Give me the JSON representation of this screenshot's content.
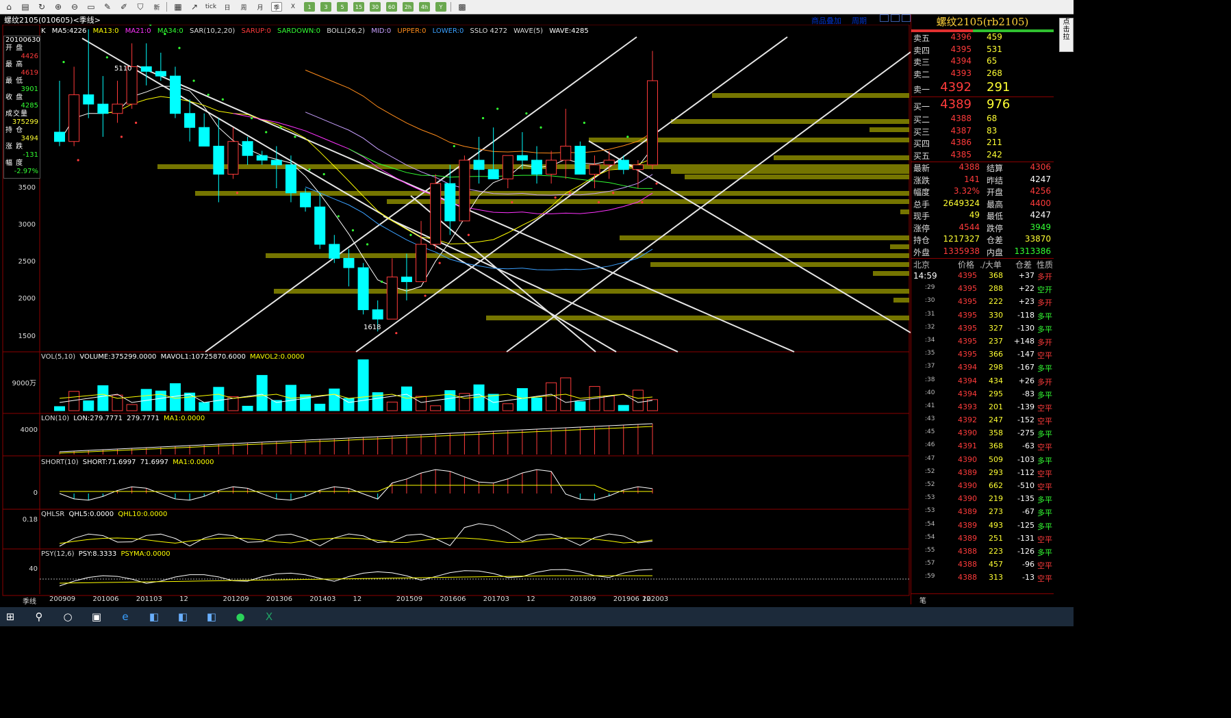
{
  "window": {
    "title": "螺纹2105(010605)<季线>",
    "links": [
      "商品叠加",
      "周期"
    ]
  },
  "toolbar": {
    "icons": [
      "home-icon",
      "folder-icon",
      "refresh-icon",
      "zoom-in-icon",
      "zoom-out-icon",
      "window-icon",
      "pen-icon",
      "brush-icon",
      "filter-icon",
      "new-icon",
      "table-icon",
      "line-chart-icon",
      "tick-icon",
      "day-icon",
      "week-icon",
      "month-icon",
      "quarter-icon",
      "x-icon",
      "p1-icon",
      "p3-icon",
      "p5-icon",
      "p15-icon",
      "p30-icon",
      "p60-icon",
      "p2h-icon",
      "p4h-icon",
      "y-icon",
      "calc-icon"
    ],
    "labels": [
      "",
      "",
      "",
      "",
      "",
      "",
      "",
      "",
      "",
      "新",
      "",
      "",
      "tick",
      "日",
      "周",
      "月",
      "季",
      "X",
      "1",
      "3",
      "5",
      "15",
      "30",
      "60",
      "2h",
      "4h",
      "Y",
      ""
    ]
  },
  "main_indicators": {
    "k_label": "K",
    "ma5": "MA5:4226",
    "ma13": "MA13:0",
    "ma21": "MA21:0",
    "ma34": "MA34:0",
    "sar": "SAR(10,2,20)",
    "sarup": "SARUP:0",
    "sardown": "SARDOWN:0",
    "boll": "BOLL(26,2)",
    "mid": "MID:0",
    "upper": "UPPER:0",
    "lower": "LOWER:0",
    "sslo": "SSLO 4272",
    "wave5": "WAVE(5)",
    "wave": "WAVE:4285"
  },
  "info_box": {
    "date": "20100630",
    "open_label": "开 盘",
    "open": "4426",
    "high_label": "最 高",
    "high": "4619",
    "low_label": "最 低",
    "low": "3901",
    "close_label": "收 盘",
    "close": "4285",
    "vol_label": "成交量",
    "vol": "375299",
    "oi_label": "持 仓",
    "oi": "3494",
    "chg_label": "涨 跌",
    "chg": "-131",
    "pct_label": "幅 度",
    "pct": "-2.97%"
  },
  "annotations": {
    "high_mark": "5110",
    "low_mark": "1618"
  },
  "price_axis": [
    "3500",
    "3000",
    "2500",
    "2000",
    "1500"
  ],
  "sub_panels": {
    "vol": {
      "title": "VOL(5,10)",
      "v1": "VOLUME:375299.0000",
      "v2": "MAVOL1:10725870.6000",
      "v3": "MAVOL2:0.0000",
      "axis": "9000万"
    },
    "lon": {
      "title": "LON(10)",
      "v1": "LON:279.7771",
      "v2": "279.7771",
      "v3": "MA1:0.0000",
      "axis": "4000"
    },
    "short": {
      "title": "SHORT(10)",
      "v1": "SHORT:71.6997",
      "v2": "71.6997",
      "v3": "MA1:0.0000",
      "axis": "0"
    },
    "qhlsr": {
      "title": "QHLSR",
      "v1": "QHL5:0.0000",
      "v2": "QHL10:0.0000",
      "axis": "0.18"
    },
    "psy": {
      "title": "PSY(12,6)",
      "v1": "PSY:8.3333",
      "v2": "PSYMA:0.0000",
      "axis": "40"
    }
  },
  "x_axis": {
    "period_label": "季线",
    "ticks": [
      "200909",
      "201006",
      "201103",
      "12",
      "201209",
      "201306",
      "201403",
      "12",
      "201509",
      "201606",
      "201703",
      "12",
      "201809",
      "201906",
      "202003",
      "12"
    ]
  },
  "right_panel": {
    "title": "螺纹2105(rb2105)",
    "asks": [
      {
        "label": "卖五",
        "price": "4396",
        "vol": "459"
      },
      {
        "label": "卖四",
        "price": "4395",
        "vol": "531"
      },
      {
        "label": "卖三",
        "price": "4394",
        "vol": "65"
      },
      {
        "label": "卖二",
        "price": "4393",
        "vol": "268"
      },
      {
        "label": "卖一",
        "price": "4392",
        "vol": "291"
      }
    ],
    "bids": [
      {
        "label": "买一",
        "price": "4389",
        "vol": "976"
      },
      {
        "label": "买二",
        "price": "4388",
        "vol": "68"
      },
      {
        "label": "买三",
        "price": "4387",
        "vol": "83"
      },
      {
        "label": "买四",
        "price": "4386",
        "vol": "211"
      },
      {
        "label": "买五",
        "price": "4385",
        "vol": "242"
      }
    ],
    "stats": [
      {
        "l1": "最新",
        "v1": "4388",
        "l2": "结算",
        "v2": "4306"
      },
      {
        "l1": "涨跌",
        "v1": "141",
        "l2": "昨结",
        "v2": "4247"
      },
      {
        "l1": "幅度",
        "v1": "3.32%",
        "l2": "开盘",
        "v2": "4256"
      },
      {
        "l1": "总手",
        "v1": "2649324",
        "l2": "最高",
        "v2": "4400"
      },
      {
        "l1": "现手",
        "v1": "49",
        "l2": "最低",
        "v2": "4247"
      },
      {
        "l1": "涨停",
        "v1": "4544",
        "l2": "跌停",
        "v2": "3949"
      },
      {
        "l1": "持仓",
        "v1": "1217327",
        "l2": "仓差",
        "v2": "33870"
      },
      {
        "l1": "外盘",
        "v1": "1335938",
        "l2": "内盘",
        "v2": "1313386"
      }
    ],
    "ticks_header": {
      "c1": "北京",
      "c2": "价格",
      "c3": "./大单",
      "c4": "仓差",
      "c5": "性质"
    },
    "ticks": [
      {
        "t": "14:59",
        "p": "4395",
        "v": "368",
        "d": "+37",
        "n": "多开"
      },
      {
        "t": ":29",
        "p": "4395",
        "v": "288",
        "d": "+22",
        "n": "空开"
      },
      {
        "t": ":30",
        "p": "4395",
        "v": "222",
        "d": "+23",
        "n": "多开"
      },
      {
        "t": ":31",
        "p": "4395",
        "v": "330",
        "d": "-118",
        "n": "多平"
      },
      {
        "t": ":32",
        "p": "4395",
        "v": "327",
        "d": "-130",
        "n": "多平"
      },
      {
        "t": ":34",
        "p": "4395",
        "v": "237",
        "d": "+148",
        "n": "多开"
      },
      {
        "t": ":35",
        "p": "4395",
        "v": "366",
        "d": "-147",
        "n": "空平"
      },
      {
        "t": ":37",
        "p": "4394",
        "v": "298",
        "d": "-167",
        "n": "多平"
      },
      {
        "t": ":38",
        "p": "4394",
        "v": "434",
        "d": "+26",
        "n": "多开"
      },
      {
        "t": ":40",
        "p": "4394",
        "v": "295",
        "d": "-83",
        "n": "多平"
      },
      {
        "t": ":41",
        "p": "4393",
        "v": "201",
        "d": "-139",
        "n": "空平"
      },
      {
        "t": ":43",
        "p": "4392",
        "v": "247",
        "d": "-152",
        "n": "空平"
      },
      {
        "t": ":45",
        "p": "4390",
        "v": "358",
        "d": "-275",
        "n": "多平"
      },
      {
        "t": ":46",
        "p": "4391",
        "v": "368",
        "d": "-63",
        "n": "空平"
      },
      {
        "t": ":47",
        "p": "4390",
        "v": "509",
        "d": "-103",
        "n": "多平"
      },
      {
        "t": ":52",
        "p": "4389",
        "v": "293",
        "d": "-112",
        "n": "空平"
      },
      {
        "t": ":52",
        "p": "4390",
        "v": "662",
        "d": "-510",
        "n": "空平"
      },
      {
        "t": ":53",
        "p": "4390",
        "v": "219",
        "d": "-135",
        "n": "多平"
      },
      {
        "t": ":53",
        "p": "4389",
        "v": "273",
        "d": "-67",
        "n": "多平"
      },
      {
        "t": ":54",
        "p": "4389",
        "v": "493",
        "d": "-125",
        "n": "多平"
      },
      {
        "t": ":54",
        "p": "4389",
        "v": "251",
        "d": "-131",
        "n": "空平"
      },
      {
        "t": ":55",
        "p": "4388",
        "v": "223",
        "d": "-126",
        "n": "多平"
      },
      {
        "t": ":57",
        "p": "4388",
        "v": "457",
        "d": "-96",
        "n": "空平"
      },
      {
        "t": ":59",
        "p": "4388",
        "v": "313",
        "d": "-13",
        "n": "空平"
      }
    ],
    "footer": "笔",
    "side_tab": "点击拉"
  },
  "colors": {
    "bull": "#ff3b3b",
    "bear": "#00ffff",
    "ma5": "#ffffff",
    "ma13": "#ffff00",
    "ma21": "#ff33ff",
    "ma34": "#33ff33",
    "sar_up": "#ff3b3b",
    "sar_down": "#33ff33",
    "upper": "#ff8c1a",
    "mid": "#c8a0ff",
    "lower": "#3aa0ff",
    "sslo": "#cccccc",
    "profile": "#8a8a00"
  },
  "chart_data": {
    "type": "candlestick",
    "period": "quarter",
    "ylim": [
      1400,
      4900
    ],
    "candles": [
      {
        "o": 3750,
        "h": 4300,
        "l": 3600,
        "c": 3650
      },
      {
        "o": 3650,
        "h": 4450,
        "l": 3600,
        "c": 4150
      },
      {
        "o": 4150,
        "h": 4850,
        "l": 3900,
        "c": 4050
      },
      {
        "o": 4050,
        "h": 4350,
        "l": 3700,
        "c": 3950
      },
      {
        "o": 3950,
        "h": 4300,
        "l": 3850,
        "c": 4050
      },
      {
        "o": 4050,
        "h": 4700,
        "l": 4000,
        "c": 4450
      },
      {
        "o": 4450,
        "h": 4700,
        "l": 4250,
        "c": 4400
      },
      {
        "o": 4400,
        "h": 4600,
        "l": 4300,
        "c": 4350
      },
      {
        "o": 4350,
        "h": 4450,
        "l": 3900,
        "c": 3950
      },
      {
        "o": 3950,
        "h": 4100,
        "l": 3650,
        "c": 3800
      },
      {
        "o": 3800,
        "h": 3950,
        "l": 3600,
        "c": 3600
      },
      {
        "o": 3600,
        "h": 3900,
        "l": 3000,
        "c": 3300
      },
      {
        "o": 3300,
        "h": 3800,
        "l": 3250,
        "c": 3650
      },
      {
        "o": 3650,
        "h": 3700,
        "l": 3400,
        "c": 3500
      },
      {
        "o": 3500,
        "h": 3550,
        "l": 3400,
        "c": 3450
      },
      {
        "o": 3450,
        "h": 3600,
        "l": 3150,
        "c": 3400
      },
      {
        "o": 3400,
        "h": 3500,
        "l": 3000,
        "c": 3100
      },
      {
        "o": 3100,
        "h": 3150,
        "l": 2900,
        "c": 2950
      },
      {
        "o": 2950,
        "h": 3100,
        "l": 2500,
        "c": 2550
      },
      {
        "o": 2550,
        "h": 2650,
        "l": 2350,
        "c": 2400
      },
      {
        "o": 2400,
        "h": 2500,
        "l": 2100,
        "c": 2300
      },
      {
        "o": 2300,
        "h": 2350,
        "l": 1800,
        "c": 1850
      },
      {
        "o": 1850,
        "h": 1950,
        "l": 1618,
        "c": 1750
      },
      {
        "o": 1750,
        "h": 2400,
        "l": 1750,
        "c": 2200
      },
      {
        "o": 2200,
        "h": 2450,
        "l": 1950,
        "c": 2150
      },
      {
        "o": 2150,
        "h": 2800,
        "l": 2150,
        "c": 2550
      },
      {
        "o": 2550,
        "h": 3300,
        "l": 2500,
        "c": 3200
      },
      {
        "o": 3200,
        "h": 3400,
        "l": 2650,
        "c": 2800
      },
      {
        "o": 2800,
        "h": 3500,
        "l": 2800,
        "c": 3450
      },
      {
        "o": 3450,
        "h": 3700,
        "l": 3200,
        "c": 3350
      },
      {
        "o": 3350,
        "h": 3800,
        "l": 3300,
        "c": 3250
      },
      {
        "o": 3250,
        "h": 3500,
        "l": 3150,
        "c": 3500
      },
      {
        "o": 3500,
        "h": 3750,
        "l": 3350,
        "c": 3450
      },
      {
        "o": 3450,
        "h": 3600,
        "l": 3200,
        "c": 3300
      },
      {
        "o": 3300,
        "h": 3550,
        "l": 3200,
        "c": 3450
      },
      {
        "o": 3450,
        "h": 4000,
        "l": 3250,
        "c": 3600
      },
      {
        "o": 3600,
        "h": 3650,
        "l": 3300,
        "c": 3300
      },
      {
        "o": 3300,
        "h": 3500,
        "l": 3150,
        "c": 3400
      },
      {
        "o": 3400,
        "h": 3550,
        "l": 3250,
        "c": 3450
      },
      {
        "o": 3450,
        "h": 3500,
        "l": 3300,
        "c": 3350
      },
      {
        "o": 3350,
        "h": 3450,
        "l": 3150,
        "c": 3400
      },
      {
        "o": 3400,
        "h": 4619,
        "l": 3350,
        "c": 4300
      }
    ]
  }
}
